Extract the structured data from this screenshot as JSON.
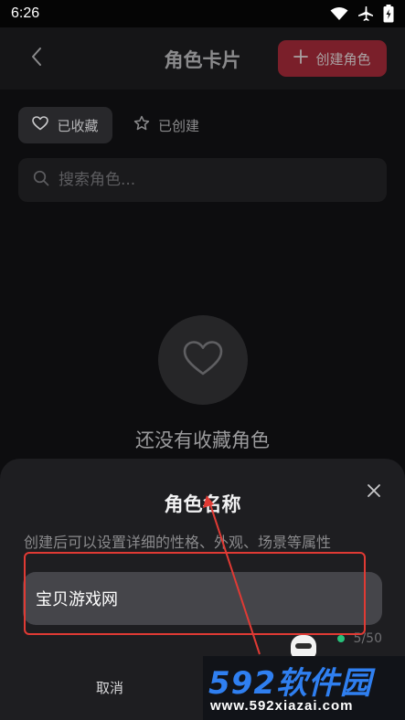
{
  "status_bar": {
    "time": "6:26",
    "icons": [
      "wifi-icon",
      "airplane-icon",
      "battery-charging-icon"
    ]
  },
  "header": {
    "title": "角色卡片",
    "back_icon": "chevron-left-icon",
    "create_button": {
      "icon": "plus-icon",
      "label": "创建角色"
    }
  },
  "tabs": [
    {
      "label": "已收藏",
      "icon": "heart-icon",
      "active": true
    },
    {
      "label": "已创建",
      "icon": "star-icon",
      "active": false
    }
  ],
  "search": {
    "placeholder": "搜索角色...",
    "icon": "search-icon",
    "value": ""
  },
  "empty_state": {
    "icon": "heart-icon",
    "text": "还没有收藏角色"
  },
  "sheet": {
    "title": "角色名称",
    "hint": "创建后可以设置详细的性格、外观、场景等属性",
    "name_value": "宝贝游戏网",
    "counter": "5/50",
    "cancel_label": "取消",
    "close_icon": "close-icon"
  },
  "watermark": {
    "main": "592软件园",
    "sub": "www.592xiazai.com"
  },
  "colors": {
    "accent": "#7a1f2a",
    "background": "#0d0d0f",
    "sheet": "#1e1e21",
    "annotation": "#e03a34",
    "watermark_blue": "#2f7ff0"
  }
}
